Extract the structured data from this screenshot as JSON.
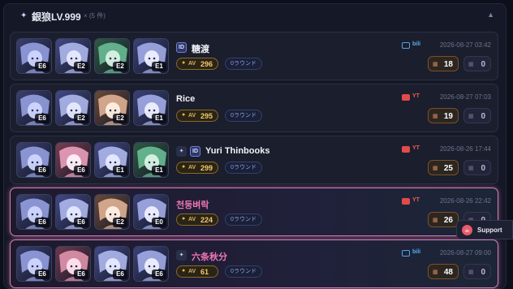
{
  "header": {
    "title": "銀狼LV.999",
    "count": "× (5 件)"
  },
  "cards": [
    {
      "eidolons": [
        "E6",
        "E2",
        "E2",
        "E1"
      ],
      "player": "糖渡",
      "player_icons": [
        "uid"
      ],
      "av": "296",
      "round": "0ラウンド",
      "source": {
        "type": "bili",
        "label": "bili"
      },
      "date": "2026-08-27 03:42",
      "stat_a": "18",
      "stat_b": "0",
      "highlight": false
    },
    {
      "eidolons": [
        "E6",
        "E2",
        "E2",
        "E1"
      ],
      "player": "Rice",
      "player_icons": [],
      "av": "295",
      "round": "0ラウンド",
      "source": {
        "type": "yt",
        "label": "YT"
      },
      "date": "2026-08-27 07:03",
      "stat_a": "19",
      "stat_b": "0",
      "highlight": false
    },
    {
      "eidolons": [
        "E6",
        "E6",
        "E1",
        "E1"
      ],
      "player": "Yuri Thinbooks",
      "player_icons": [
        "ua",
        "uid"
      ],
      "av": "299",
      "round": "0ラウンド",
      "source": {
        "type": "yt",
        "label": "YT"
      },
      "date": "2026-08-26 17:44",
      "stat_a": "25",
      "stat_b": "0",
      "highlight": false
    },
    {
      "eidolons": [
        "E6",
        "E6",
        "E2",
        "E0"
      ],
      "player": "천둥벼락",
      "player_icons": [],
      "av": "224",
      "round": "0ラウンド",
      "source": {
        "type": "yt",
        "label": "YT"
      },
      "date": "2026-08-26 22:42",
      "stat_a": "26",
      "stat_b": "0",
      "highlight": true
    },
    {
      "eidolons": [
        "E6",
        "E6",
        "E6",
        "E6"
      ],
      "player": "六条秋分",
      "player_icons": [
        "ua"
      ],
      "av": "61",
      "round": "0ラウンド",
      "source": {
        "type": "bili",
        "label": "bili"
      },
      "date": "2026-08-27 09:00",
      "stat_a": "48",
      "stat_b": "0",
      "highlight": true
    }
  ],
  "labels": {
    "av": "AV",
    "uid_icon": "UID",
    "ua_icon": "HSR",
    "stat_a_icon": "▦",
    "stat_b_icon": "▦"
  },
  "support": {
    "label": "Support"
  },
  "icons": {
    "header": "sparkle-icon",
    "collapse": "chevron-up-icon",
    "star": "star-icon",
    "support": "coffee-cup-icon"
  },
  "colors": {
    "background": "#0d0f1a",
    "panel": "#151826",
    "card": "#1b1e2c",
    "highlight_border": "#d37fb7",
    "av_gold": "#f3c86a",
    "pink_name": "#f077b5",
    "bili_blue": "#57aaf0",
    "yt_red": "#ee5a5a",
    "support_red": "#e65a6c"
  }
}
